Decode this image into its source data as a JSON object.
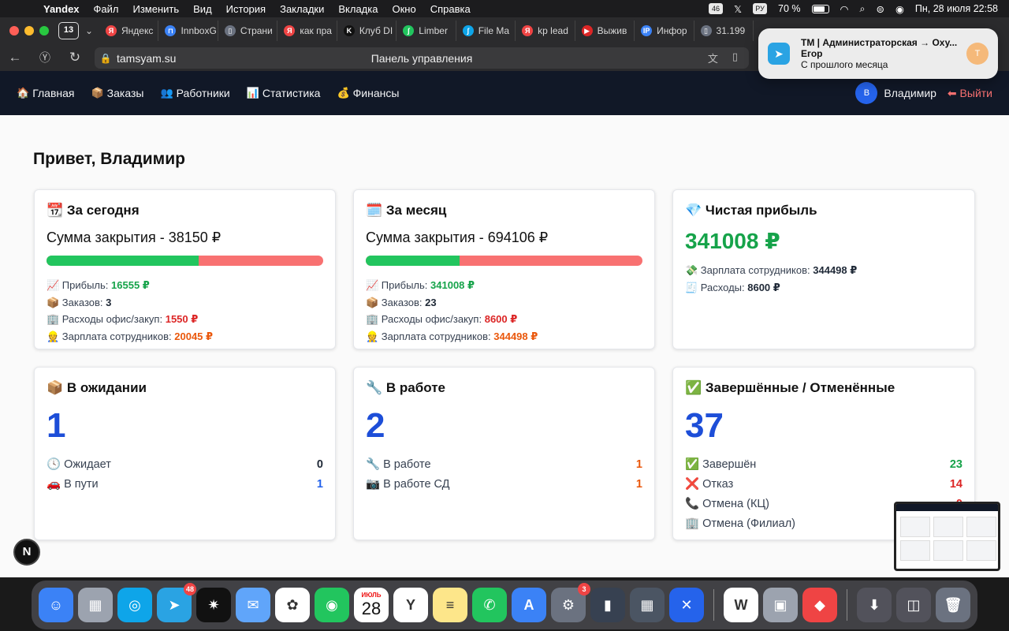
{
  "menubar": {
    "app": "Yandex",
    "items": [
      "Файл",
      "Изменить",
      "Вид",
      "История",
      "Закладки",
      "Вкладка",
      "Окно",
      "Справка"
    ],
    "badge_count": "46",
    "lang": "РУ",
    "battery": "70 %",
    "datetime": "Пн, 28 июля  22:58"
  },
  "browser": {
    "tab_count": "13",
    "tabs": [
      {
        "label": "Яндекс",
        "icon": "yandex-icon",
        "color": "#ef4444",
        "glyph": "Я"
      },
      {
        "label": "InnboxG",
        "icon": "innbox-icon",
        "color": "#3b82f6",
        "glyph": "⊓"
      },
      {
        "label": "Страни",
        "icon": "page-icon",
        "color": "#6b7280",
        "glyph": "▯"
      },
      {
        "label": "как пра",
        "icon": "yandex-icon",
        "color": "#ef4444",
        "glyph": "Я"
      },
      {
        "label": "Клуб DI",
        "icon": "k-icon",
        "color": "#111",
        "glyph": "K"
      },
      {
        "label": "Limber",
        "icon": "limber-icon",
        "color": "#22c55e",
        "glyph": "ʃ"
      },
      {
        "label": "File Ma",
        "icon": "file-manager-icon",
        "color": "#0ea5e9",
        "glyph": "ʃ"
      },
      {
        "label": "kp lead",
        "icon": "yandex-icon",
        "color": "#ef4444",
        "glyph": "Я"
      },
      {
        "label": "Выжив",
        "icon": "youtube-icon",
        "color": "#dc2626",
        "glyph": "▶"
      },
      {
        "label": "Инфор",
        "icon": "ip-icon",
        "color": "#3b82f6",
        "glyph": "IP"
      },
      {
        "label": "31.199",
        "icon": "page-icon",
        "color": "#6b7280",
        "glyph": "▯"
      }
    ],
    "url": "tamsyam.su",
    "page_title": "Панель управления"
  },
  "notification": {
    "title": "TM | Администраторская → Оху...",
    "sender": "Егор",
    "message": "С прошлого месяца",
    "avatar": "T"
  },
  "nav": {
    "links": [
      {
        "emoji": "🏠",
        "label": "Главная"
      },
      {
        "emoji": "📦",
        "label": "Заказы"
      },
      {
        "emoji": "👥",
        "label": "Работники"
      },
      {
        "emoji": "📊",
        "label": "Статистика"
      },
      {
        "emoji": "💰",
        "label": "Финансы"
      }
    ],
    "avatar": "В",
    "user": "Владимир",
    "logout": "⬅ Выйти"
  },
  "greeting": "Привет, Владимир",
  "today": {
    "title": "📆 За сегодня",
    "sum": "Сумма закрытия - 38150 ₽",
    "progress": 0.55,
    "profit_label": "📈 Прибыль:",
    "profit": "16555 ₽",
    "orders_label": "📦 Заказов:",
    "orders": "3",
    "expenses_label": "🏢 Расходы офис/закуп:",
    "expenses": "1550 ₽",
    "salary_label": "👷 Зарплата сотрудников:",
    "salary": "20045 ₽"
  },
  "month": {
    "title": "🗓️ За месяц",
    "sum": "Сумма закрытия - 694106 ₽",
    "progress": 0.34,
    "profit_label": "📈 Прибыль:",
    "profit": "341008 ₽",
    "orders_label": "📦 Заказов:",
    "orders": "23",
    "expenses_label": "🏢 Расходы офис/закуп:",
    "expenses": "8600 ₽",
    "salary_label": "👷 Зарплата сотрудников:",
    "salary": "344498 ₽"
  },
  "net": {
    "title": "💎 Чистая прибыль",
    "value": "341008 ₽",
    "salary_label": "💸 Зарплата сотрудников:",
    "salary": "344498 ₽",
    "expenses_label": "🧾 Расходы:",
    "expenses": "8600 ₽"
  },
  "waiting": {
    "title": "📦 В ожидании",
    "count": "1",
    "rows": [
      {
        "label": "🕓 Ожидает",
        "value": "0",
        "color": "#1f2937"
      },
      {
        "label": "🚗 В пути",
        "value": "1",
        "color": "#2563eb"
      }
    ]
  },
  "inwork": {
    "title": "🔧 В работе",
    "count": "2",
    "rows": [
      {
        "label": "🔧 В работе",
        "value": "1",
        "color": "#ea580c"
      },
      {
        "label": "📷 В работе СД",
        "value": "1",
        "color": "#ea580c"
      }
    ]
  },
  "done": {
    "title": "✅ Завершённые / Отменённые",
    "count": "37",
    "rows": [
      {
        "label": "✅ Завершён",
        "value": "23",
        "color": "#16a34a"
      },
      {
        "label": "❌ Отказ",
        "value": "14",
        "color": "#dc2626"
      },
      {
        "label": "📞 Отмена (КЦ)",
        "value": "0",
        "color": "#dc2626"
      },
      {
        "label": "🏢 Отмена (Филиал)",
        "value": "",
        "color": "#dc2626"
      }
    ]
  },
  "fab": "N",
  "dock": [
    {
      "name": "finder-icon",
      "bg": "#3b82f6",
      "glyph": "☺"
    },
    {
      "name": "launchpad-icon",
      "bg": "#9ca3af",
      "glyph": "▦"
    },
    {
      "name": "safari-icon",
      "bg": "#0ea5e9",
      "glyph": "◎"
    },
    {
      "name": "telegram-icon",
      "bg": "#2aa3e3",
      "glyph": "➤",
      "badge": "48"
    },
    {
      "name": "spark-icon",
      "bg": "#111",
      "glyph": "✷"
    },
    {
      "name": "mail-icon",
      "bg": "#60a5fa",
      "glyph": "✉"
    },
    {
      "name": "photos-icon",
      "bg": "#fff",
      "glyph": "✿"
    },
    {
      "name": "findmy-icon",
      "bg": "#22c55e",
      "glyph": "◉"
    },
    {
      "name": "calendar-icon",
      "month": "ИЮЛЬ",
      "day": "28"
    },
    {
      "name": "yandex-browser-icon",
      "bg": "#fff",
      "glyph": "Y"
    },
    {
      "name": "notes-icon",
      "bg": "#fde68a",
      "glyph": "≡"
    },
    {
      "name": "whatsapp-icon",
      "bg": "#22c55e",
      "glyph": "✆"
    },
    {
      "name": "appstore-icon",
      "bg": "#3b82f6",
      "glyph": "A"
    },
    {
      "name": "settings-icon",
      "bg": "#6b7280",
      "glyph": "⚙",
      "badge": "3"
    },
    {
      "name": "iphone-mirroring-icon",
      "bg": "#374151",
      "glyph": "▮"
    },
    {
      "name": "calculator-icon",
      "bg": "#4b5563",
      "glyph": "▦"
    },
    {
      "name": "xcode-icon",
      "bg": "#2563eb",
      "glyph": "✕"
    },
    {
      "name": "word-icon",
      "bg": "#fff",
      "glyph": "W"
    },
    {
      "name": "preview-icon",
      "bg": "#9ca3af",
      "glyph": "▣"
    },
    {
      "name": "anydesk-icon",
      "bg": "#ef4444",
      "glyph": "◆"
    },
    {
      "name": "downloads-icon",
      "bg": "#52525b",
      "glyph": "⬇"
    },
    {
      "name": "screenshot-icon",
      "bg": "#52525b",
      "glyph": "◫"
    },
    {
      "name": "trash-icon",
      "bg": "#6b7280",
      "glyph": "🗑"
    }
  ]
}
